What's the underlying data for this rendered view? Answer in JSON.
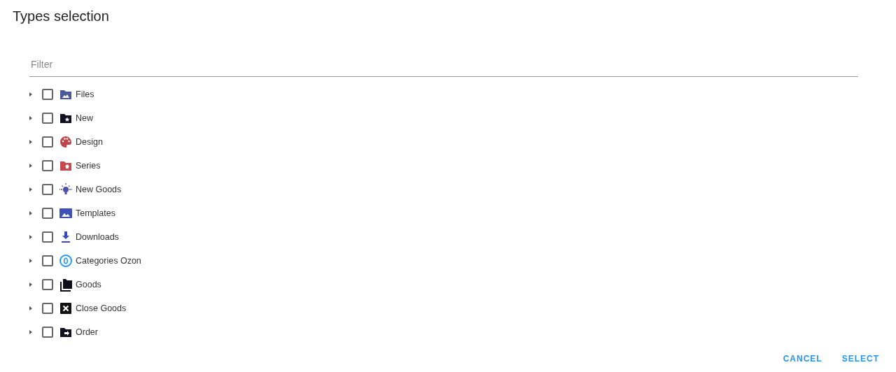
{
  "title": "Types selection",
  "filter": {
    "placeholder": "Filter"
  },
  "items": [
    {
      "label": "Files",
      "kind": "folder-image",
      "color": "#4a5a99",
      "checked": false,
      "expanded": false
    },
    {
      "label": "New",
      "kind": "folder-star",
      "color": "#111122",
      "checked": false,
      "expanded": false
    },
    {
      "label": "Design",
      "kind": "palette",
      "color": "#c0464b",
      "checked": false,
      "expanded": false
    },
    {
      "label": "Series",
      "kind": "folder-home",
      "color": "#c9474f",
      "checked": false,
      "expanded": false
    },
    {
      "label": "New Goods",
      "kind": "bulb",
      "color": "#4a4fa8",
      "checked": false,
      "expanded": false
    },
    {
      "label": "Templates",
      "kind": "image",
      "color": "#3f51b5",
      "checked": false,
      "expanded": false
    },
    {
      "label": "Downloads",
      "kind": "download",
      "color": "#3949c4",
      "checked": false,
      "expanded": false
    },
    {
      "label": "Categories Ozon",
      "kind": "ring",
      "color": "#2196f3",
      "checked": false,
      "expanded": false
    },
    {
      "label": "Goods",
      "kind": "folders",
      "color": "#0d0d1a",
      "checked": false,
      "expanded": false
    },
    {
      "label": "Close Goods",
      "kind": "close-box",
      "color": "#111111",
      "checked": false,
      "expanded": false
    },
    {
      "label": "Order",
      "kind": "folder-arrow",
      "color": "#111122",
      "checked": false,
      "expanded": false
    }
  ],
  "buttons": [
    {
      "label": "CANCEL"
    },
    {
      "label": "SELECT"
    }
  ]
}
